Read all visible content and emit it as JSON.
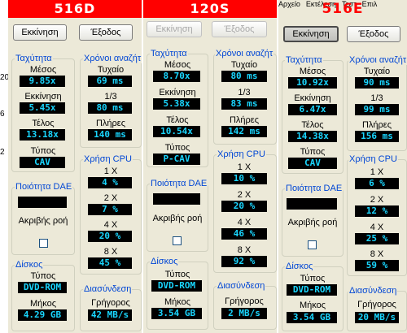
{
  "colors": {
    "title_bar": "#ff0000",
    "value_text": "#19d6ff",
    "value_bg": "#000000",
    "group_label": "#0046d5",
    "window_bg": "#ece9d8"
  },
  "left_ticks": [
    "20",
    "6",
    "2"
  ],
  "menu": [
    "Αρχείο",
    "Εκτέλεση",
    "Τεστ",
    "Επιλ"
  ],
  "panels": [
    {
      "title": "516D",
      "start": "Εκκίνηση",
      "exit": "Έξοδος",
      "speed": {
        "label": "Ταχύτητα",
        "avg_label": "Μέσος",
        "avg": "9.85x",
        "start_label": "Εκκίνηση",
        "start": "5.45x",
        "end_label": "Τέλος",
        "end": "13.18x",
        "type_label": "Τύπος",
        "type": "CAV"
      },
      "seek": {
        "label": "Χρόνοι αναζήτ",
        "random_label": "Τυχαίο",
        "random": "69 ms",
        "third_label": "1/3",
        "third": "80 ms",
        "full_label": "Πλήρες",
        "full": "140 ms"
      },
      "cpu": {
        "label": "Χρήση CPU",
        "r1_label": "1 X",
        "r1": "4 %",
        "r2_label": "2 X",
        "r2": "7 %",
        "r4_label": "4 X",
        "r4": "20 %",
        "r8_label": "8 X",
        "r8": "45 %"
      },
      "dae": {
        "label": "Ποιότητα DAE",
        "accurate_label": "Ακριβής ροή"
      },
      "disk": {
        "label": "Δίσκος",
        "type_label": "Τύπος",
        "type": "DVD-ROM",
        "length_label": "Μήκος",
        "length": "4.29 GB"
      },
      "iface": {
        "label": "Διασύνδεση",
        "fast_label": "Γρήγορος",
        "fast": "42 MB/s"
      }
    },
    {
      "title": "120S",
      "start": "Εκκίνηση",
      "exit": "Έξοδος",
      "speed": {
        "label": "Ταχύτητα",
        "avg_label": "Μέσος",
        "avg": "8.70x",
        "start_label": "Εκκίνηση",
        "start": "5.38x",
        "end_label": "Τέλος",
        "end": "10.54x",
        "type_label": "Τύπος",
        "type": "P-CAV"
      },
      "seek": {
        "label": "Χρόνοι αναζήτ",
        "random_label": "Τυχαίο",
        "random": "80 ms",
        "third_label": "1/3",
        "third": "83 ms",
        "full_label": "Πλήρες",
        "full": "142 ms"
      },
      "cpu": {
        "label": "Χρήση CPU",
        "r1_label": "1 X",
        "r1": "10 %",
        "r2_label": "2 X",
        "r2": "20 %",
        "r4_label": "4 X",
        "r4": "46 %",
        "r8_label": "8 X",
        "r8": "92 %"
      },
      "dae": {
        "label": "Ποιότητα DAE",
        "accurate_label": "Ακριβής ροή"
      },
      "disk": {
        "label": "Δίσκος",
        "type_label": "Τύπος",
        "type": "DVD-ROM",
        "length_label": "Μήκος",
        "length": "3.54 GB"
      },
      "iface": {
        "label": "Διασύνδεση",
        "fast_label": "Γρήγορος",
        "fast": "2 MB/s"
      }
    },
    {
      "title": "516E",
      "start": "Εκκίνηση",
      "exit": "Έξοδος",
      "speed": {
        "label": "Ταχύτητα",
        "avg_label": "Μέσος",
        "avg": "10.92x",
        "start_label": "Εκκίνηση",
        "start": "6.47x",
        "end_label": "Τέλος",
        "end": "14.38x",
        "type_label": "Τύπος",
        "type": "CAV"
      },
      "seek": {
        "label": "Χρόνοι αναζήτ",
        "random_label": "Τυχαίο",
        "random": "90 ms",
        "third_label": "1/3",
        "third": "99 ms",
        "full_label": "Πλήρες",
        "full": "156 ms"
      },
      "cpu": {
        "label": "Χρήση CPU",
        "r1_label": "1 X",
        "r1": "6 %",
        "r2_label": "2 X",
        "r2": "12 %",
        "r4_label": "4 X",
        "r4": "25 %",
        "r8_label": "8 X",
        "r8": "59 %"
      },
      "dae": {
        "label": "Ποιότητα DAE",
        "accurate_label": "Ακριβής ροή"
      },
      "disk": {
        "label": "Δίσκος",
        "type_label": "Τύπος",
        "type": "DVD-ROM",
        "length_label": "Μήκος",
        "length": "3.54 GB"
      },
      "iface": {
        "label": "Διασύνδεση",
        "fast_label": "Γρήγορος",
        "fast": "20 MB/s"
      }
    }
  ]
}
